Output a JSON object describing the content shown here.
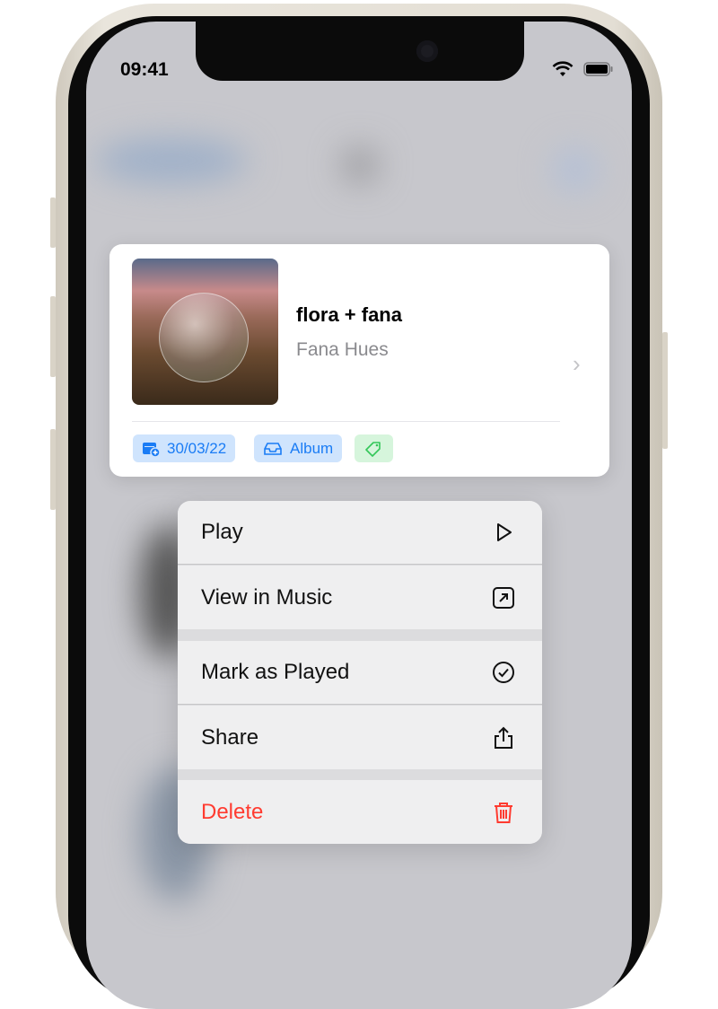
{
  "status_bar": {
    "time": "09:41"
  },
  "preview": {
    "title": "flora + fana",
    "artist": "Fana Hues",
    "chips": [
      {
        "label": "30/03/22",
        "icon": "calendar-badge-plus-icon"
      },
      {
        "label": "Album",
        "icon": "tray-icon"
      },
      {
        "label": "",
        "icon": "tag-icon"
      }
    ]
  },
  "menu": {
    "items": [
      {
        "label": "Play",
        "icon": "play-icon"
      },
      {
        "label": "View in Music",
        "icon": "arrow-up-right-square-icon"
      },
      {
        "label": "Mark as Played",
        "icon": "checkmark-circle-icon"
      },
      {
        "label": "Share",
        "icon": "share-icon"
      },
      {
        "label": "Delete",
        "icon": "trash-icon"
      }
    ]
  },
  "colors": {
    "accent": "#1a7cf5",
    "destructive": "#ff3b30",
    "tag_green": "#34c759"
  }
}
